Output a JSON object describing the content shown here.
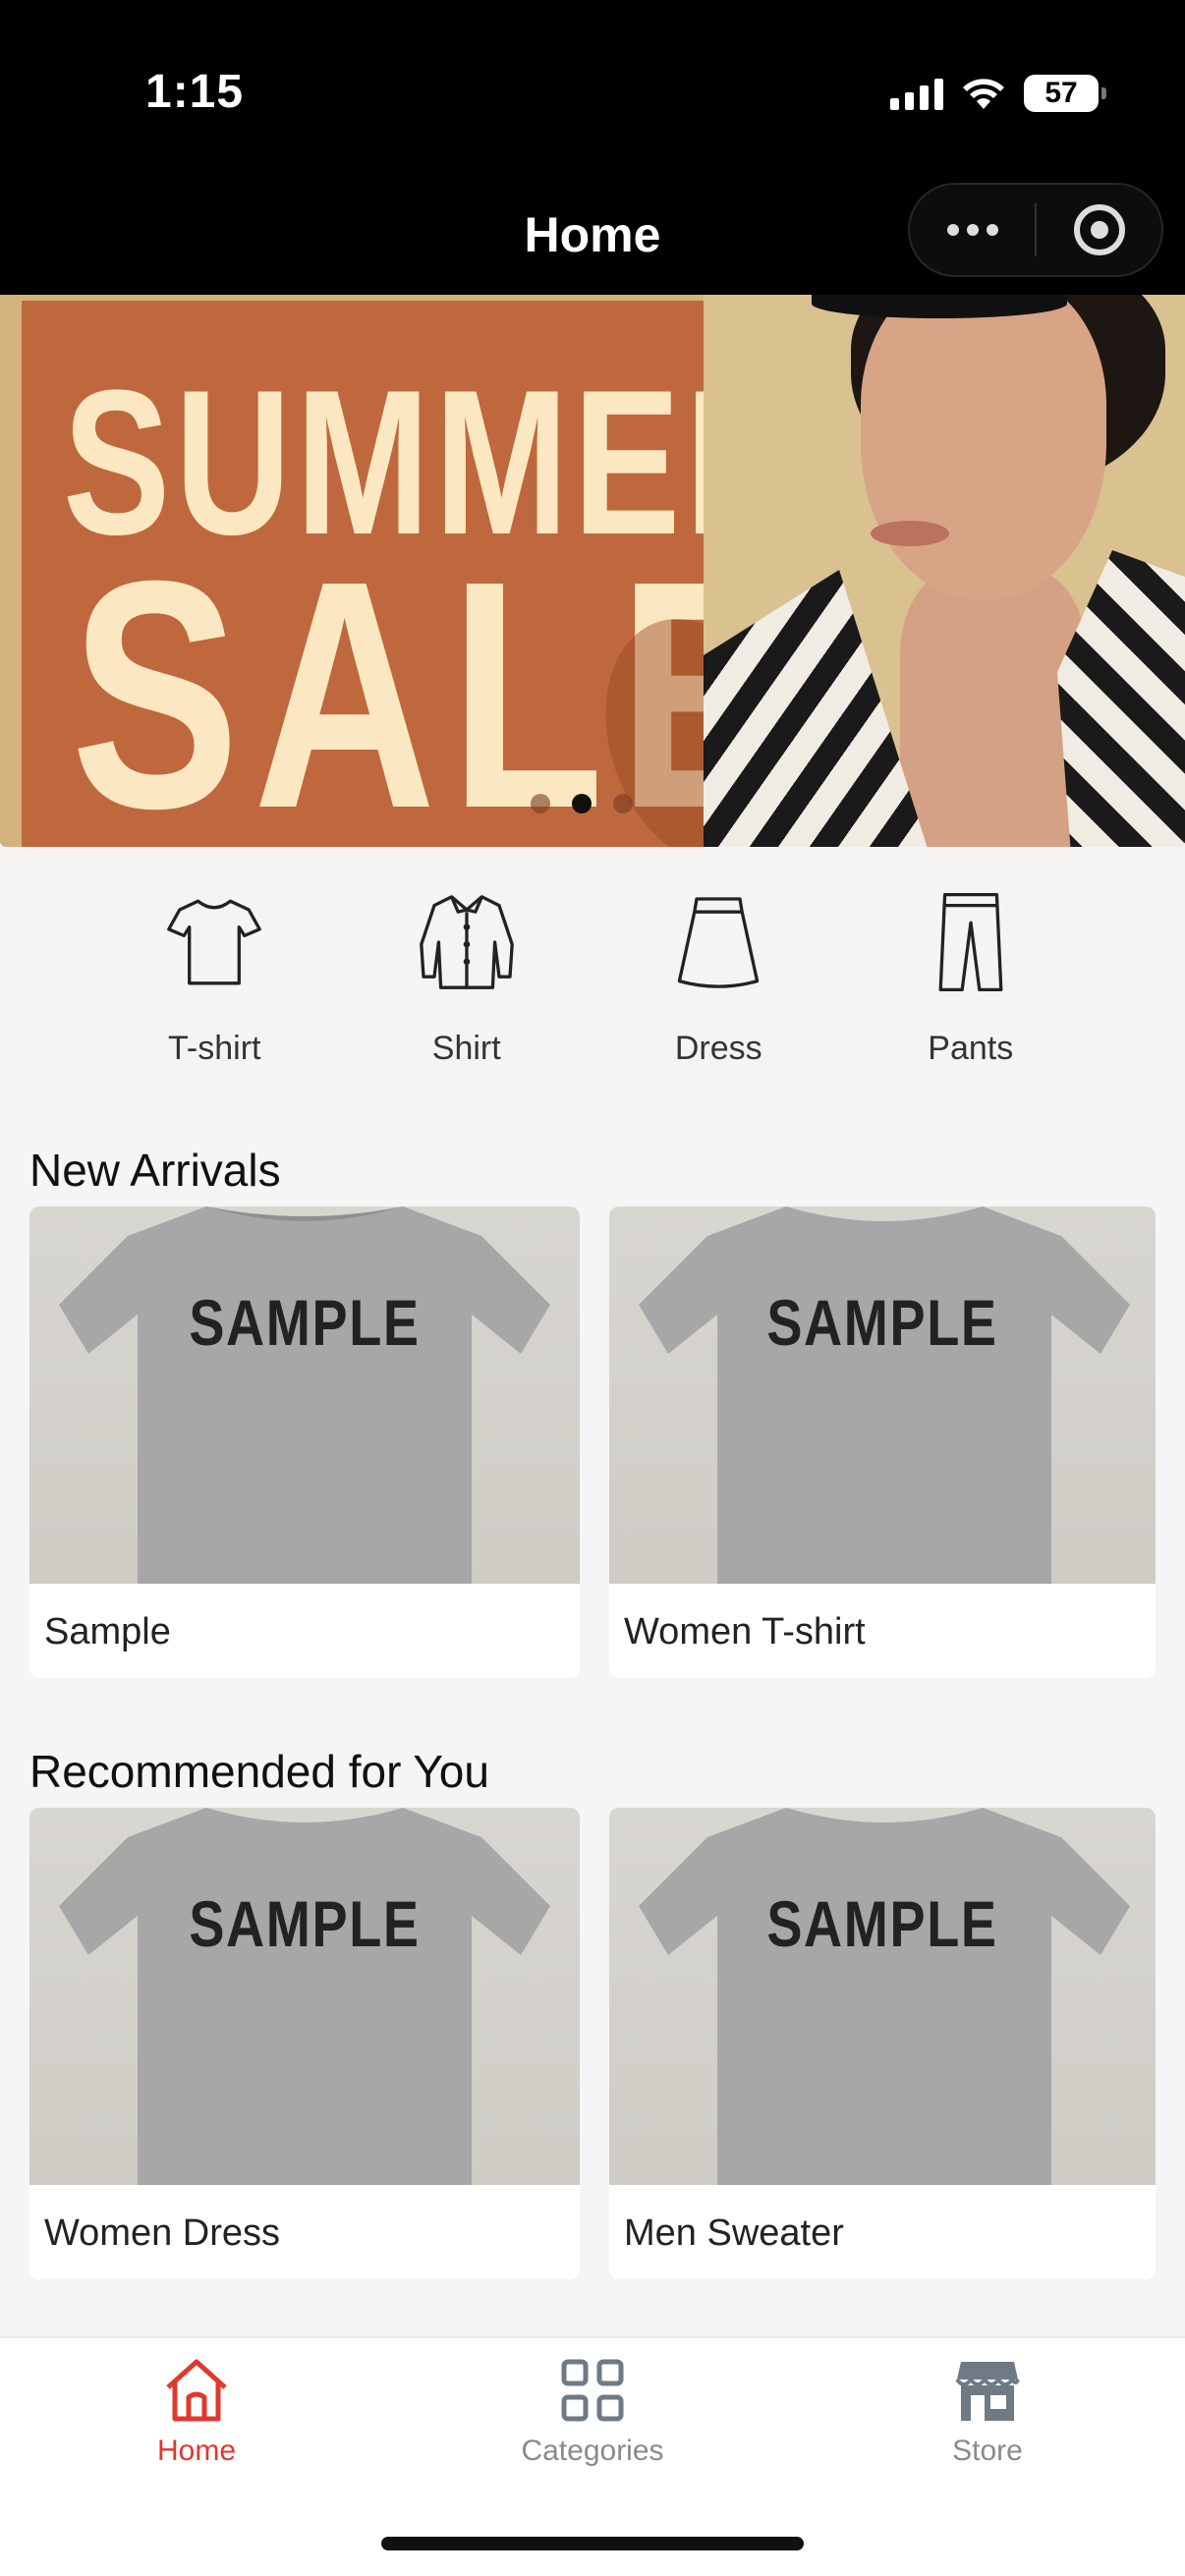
{
  "status_bar": {
    "time": "1:15",
    "battery": "57"
  },
  "nav": {
    "title": "Home"
  },
  "banner": {
    "line1": "SUMMER",
    "line2": "SALE",
    "active_slide": 2,
    "slide_count": 3
  },
  "categories": [
    {
      "label": "T-shirt",
      "icon": "tshirt-icon"
    },
    {
      "label": "Shirt",
      "icon": "shirt-icon"
    },
    {
      "label": "Dress",
      "icon": "dress-icon"
    },
    {
      "label": "Pants",
      "icon": "pants-icon"
    }
  ],
  "new_arrivals": {
    "title": "New Arrivals",
    "items": [
      {
        "image_text": "SAMPLE",
        "name": "Sample"
      },
      {
        "image_text": "SAMPLE",
        "name": "Women T-shirt"
      }
    ]
  },
  "recommended": {
    "title": "Recommended for You",
    "items": [
      {
        "image_text": "SAMPLE",
        "name": "Women Dress"
      },
      {
        "image_text": "SAMPLE",
        "name": "Men Sweater"
      }
    ]
  },
  "tabbar": {
    "items": [
      {
        "label": "Home",
        "icon": "home-icon",
        "active": true
      },
      {
        "label": "Categories",
        "icon": "grid-icon",
        "active": false
      },
      {
        "label": "Store",
        "icon": "store-icon",
        "active": false
      }
    ]
  },
  "colors": {
    "accent": "#e0382e",
    "banner_orange": "#bf683d",
    "banner_text": "#fbe7c1"
  }
}
